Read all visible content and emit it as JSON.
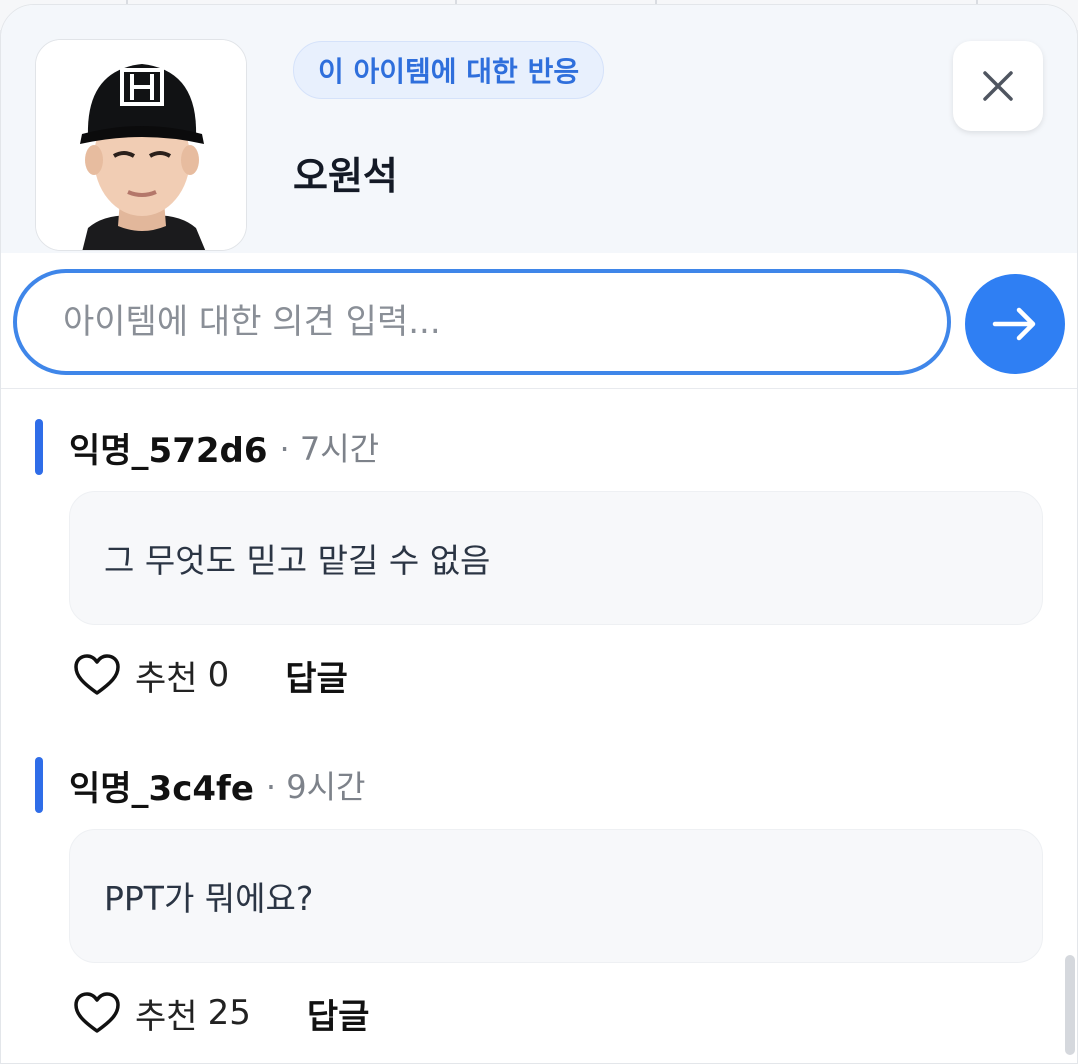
{
  "item": {
    "tag_label": "이 아이템에 대한 반응",
    "name": "오원석",
    "avatar_icon": "player-photo",
    "close_icon": "close-icon"
  },
  "composer": {
    "placeholder": "아이템에 대한 의견 입력...",
    "send_icon": "arrow-right-icon"
  },
  "colors": {
    "accent": "#2f7ff3",
    "tag_text": "#2f6fdc",
    "bar": "#2f6de8"
  },
  "comments": [
    {
      "author": "익명_572d6",
      "time": "· 7시간",
      "text": "그 무엇도 믿고 맡길 수 없음",
      "like_label": "추천",
      "like_count": "0",
      "reply_label": "답글"
    },
    {
      "author": "익명_3c4fe",
      "time": "· 9시간",
      "text": "PPT가 뭐에요?",
      "like_label": "추천",
      "like_count": "25",
      "reply_label": "답글"
    }
  ]
}
